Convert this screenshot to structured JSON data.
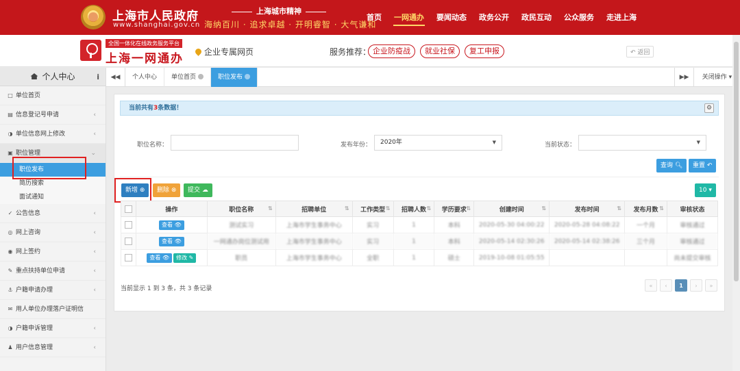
{
  "gov": {
    "title": "上海市人民政府",
    "url": "www.shanghai.gov.cn",
    "spirit_title": "上海城市精神",
    "spirit_slogan": "海纳百川 · 追求卓越 · 开明睿智 · 大气谦和",
    "nav": [
      "首页",
      "一网通办",
      "要闻动态",
      "政务公开",
      "政民互动",
      "公众服务",
      "走进上海"
    ],
    "nav_active": "一网通办"
  },
  "platform": {
    "tag": "全国一体化在线政务服务平台",
    "name": "上海一网通办",
    "location": "企业专属网页",
    "recommend_label": "服务推荐：",
    "pills": [
      "企业防疫战",
      "就业社保",
      "复工申报"
    ],
    "back": "返回"
  },
  "sidebar": {
    "header": "个人中心",
    "items": [
      {
        "icon": "□",
        "label": "单位首页",
        "chev": ""
      },
      {
        "icon": "▤",
        "label": "信息登记号申请",
        "chev": "‹"
      },
      {
        "icon": "◑",
        "label": "单位信息网上修改",
        "chev": "‹"
      },
      {
        "icon": "▣",
        "label": "职位管理",
        "chev": "⌄"
      }
    ],
    "subitems": [
      "职位发布",
      "简历搜索",
      "面试通知"
    ],
    "items_after": [
      {
        "icon": "✓",
        "label": "公告信息",
        "chev": "‹"
      },
      {
        "icon": "◎",
        "label": "网上咨询",
        "chev": "‹"
      },
      {
        "icon": "◉",
        "label": "网上签约",
        "chev": "‹"
      },
      {
        "icon": "✎",
        "label": "重点扶持单位申请",
        "chev": "‹"
      },
      {
        "icon": "⚓",
        "label": "户籍申请办理",
        "chev": "‹"
      },
      {
        "icon": "✉",
        "label": "用人单位办理落户证明信",
        "chev": ""
      },
      {
        "icon": "◑",
        "label": "户籍申诉管理",
        "chev": "‹"
      },
      {
        "icon": "♟",
        "label": "用户信息管理",
        "chev": "‹"
      }
    ]
  },
  "tabs": {
    "items": [
      "个人中心",
      "单位首页",
      "职位发布"
    ],
    "close_ops": "关闭操作"
  },
  "notice": {
    "prefix": "当前共有",
    "count": "3",
    "suffix": "条数据！"
  },
  "filters": {
    "job_name_label": "职位名称：",
    "job_name_value": "",
    "year_label": "发布年份：",
    "year_value": "2020年",
    "status_label": "当前状态：",
    "status_value": ""
  },
  "buttons": {
    "search": "查询",
    "reset": "重置",
    "add": "新增",
    "delete": "删除",
    "submit": "提交",
    "page_size": "10"
  },
  "table": {
    "headers": [
      "操作",
      "职位名称",
      "招聘单位",
      "工作类型",
      "招聘人数",
      "学历要求",
      "创建时间",
      "发布时间",
      "发布月数",
      "审核状态"
    ],
    "rows": [
      {
        "actions": [
          "查看"
        ],
        "name": "测试实习",
        "unit": "上海市学生事务中心",
        "type": "实习",
        "count": "1",
        "edu": "本科",
        "created": "2020-05-30 04:00:22",
        "published": "2020-05-28 04:08:22",
        "months": "一个月",
        "status": "审核通过"
      },
      {
        "actions": [
          "查看"
        ],
        "name": "一网通办岗位测试用",
        "unit": "上海市学生事务中心",
        "type": "实习",
        "count": "1",
        "edu": "本科",
        "created": "2020-05-14 02:30:26",
        "published": "2020-05-14 02:38:26",
        "months": "三个月",
        "status": "审核通过"
      },
      {
        "actions": [
          "查看",
          "修改"
        ],
        "name": "职员",
        "unit": "上海市学生事务中心",
        "type": "全职",
        "count": "1",
        "edu": "硕士",
        "created": "2019-10-08 01:05:55",
        "published": "",
        "months": "",
        "status": "尚未提交审核"
      }
    ]
  },
  "footer": {
    "info": "当前显示 1 到 3 条，共 3 条记录",
    "current_page": "1"
  }
}
